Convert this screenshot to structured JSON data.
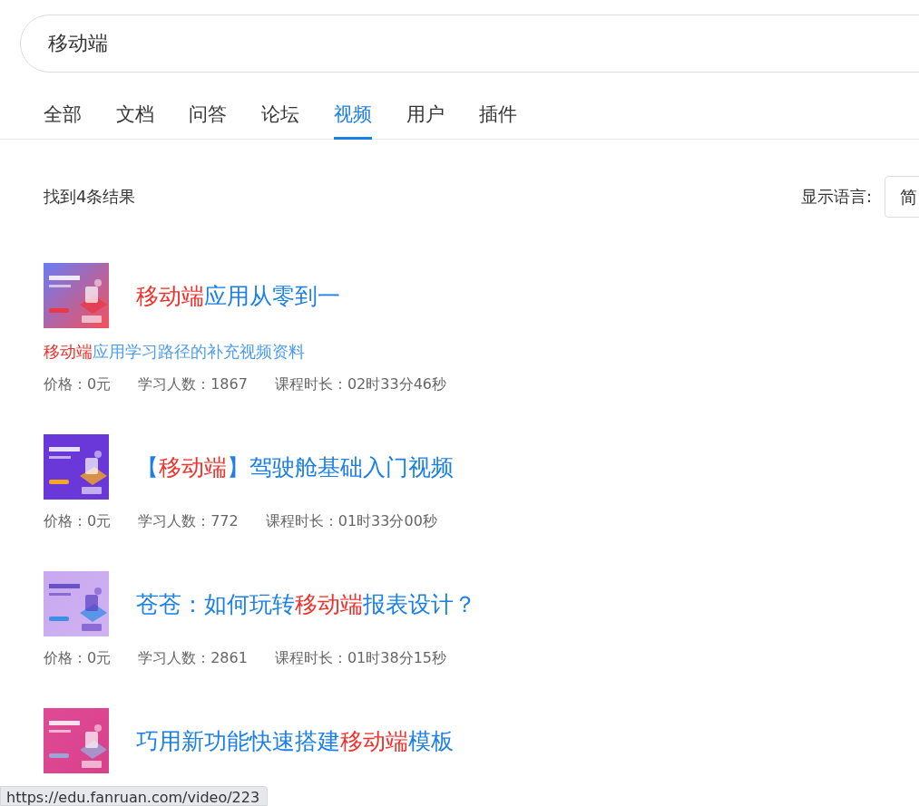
{
  "search": {
    "value": "移动端"
  },
  "tabs": [
    {
      "label": "全部",
      "selected": false
    },
    {
      "label": "文档",
      "selected": false
    },
    {
      "label": "问答",
      "selected": false
    },
    {
      "label": "论坛",
      "selected": false
    },
    {
      "label": "视频",
      "selected": true
    },
    {
      "label": "用户",
      "selected": false
    },
    {
      "label": "插件",
      "selected": false
    }
  ],
  "result_count": "找到4条结果",
  "language": {
    "label": "显示语言:",
    "value": "简"
  },
  "results": [
    {
      "title": [
        {
          "text": "移动端",
          "highlight": true
        },
        {
          "text": "应用从零到一",
          "highlight": false
        }
      ],
      "description": [
        {
          "text": "移动端",
          "highlight": true
        },
        {
          "text": "应用学习路径的补充视频资料",
          "highlight": false
        }
      ],
      "meta": [
        "价格：0元",
        "学习人数：1867",
        "课程时长：02时33分46秒"
      ]
    },
    {
      "title": [
        {
          "text": "【",
          "highlight": false
        },
        {
          "text": "移动端",
          "highlight": true
        },
        {
          "text": "】驾驶舱基础入门视频",
          "highlight": false
        }
      ],
      "meta": [
        "价格：0元",
        "学习人数：772",
        "课程时长：01时33分00秒"
      ]
    },
    {
      "title": [
        {
          "text": "苍苍：如何玩转",
          "highlight": false
        },
        {
          "text": "移动端",
          "highlight": true
        },
        {
          "text": "报表设计？",
          "highlight": false
        }
      ],
      "meta": [
        "价格：0元",
        "学习人数：2861",
        "课程时长：01时38分15秒"
      ]
    },
    {
      "title": [
        {
          "text": "巧用新功能快速搭建",
          "highlight": false
        },
        {
          "text": "移动端",
          "highlight": true
        },
        {
          "text": "模板",
          "highlight": false
        }
      ]
    }
  ],
  "status_bar": {
    "url": "https://edu.fanruan.com/video/223"
  }
}
